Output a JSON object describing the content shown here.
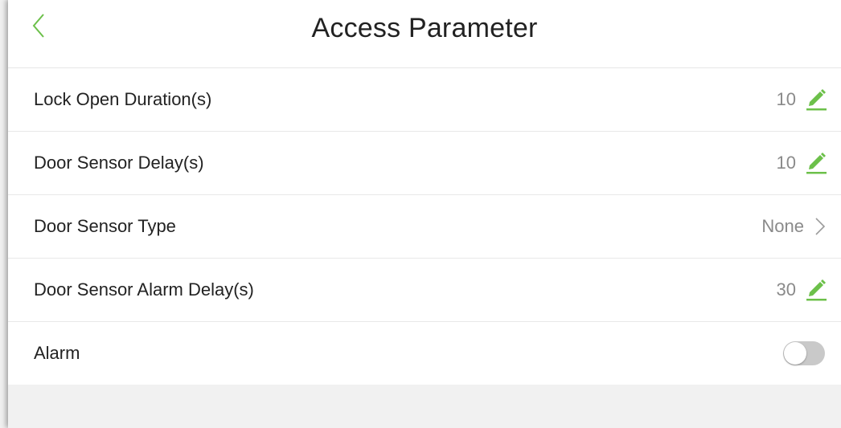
{
  "header": {
    "title": "Access Parameter",
    "back_icon": "chevron-left-icon",
    "accent_color": "#6cc04a"
  },
  "settings": [
    {
      "label": "Lock Open Duration(s)",
      "value": "10",
      "control": "edit",
      "icon": "pencil-icon"
    },
    {
      "label": "Door Sensor Delay(s)",
      "value": "10",
      "control": "edit",
      "icon": "pencil-icon"
    },
    {
      "label": "Door Sensor Type",
      "value": "None",
      "control": "select",
      "icon": "chevron-right-icon"
    },
    {
      "label": "Door Sensor Alarm Delay(s)",
      "value": "30",
      "control": "edit",
      "icon": "pencil-icon"
    },
    {
      "label": "Alarm",
      "control": "toggle",
      "state": "off"
    }
  ]
}
